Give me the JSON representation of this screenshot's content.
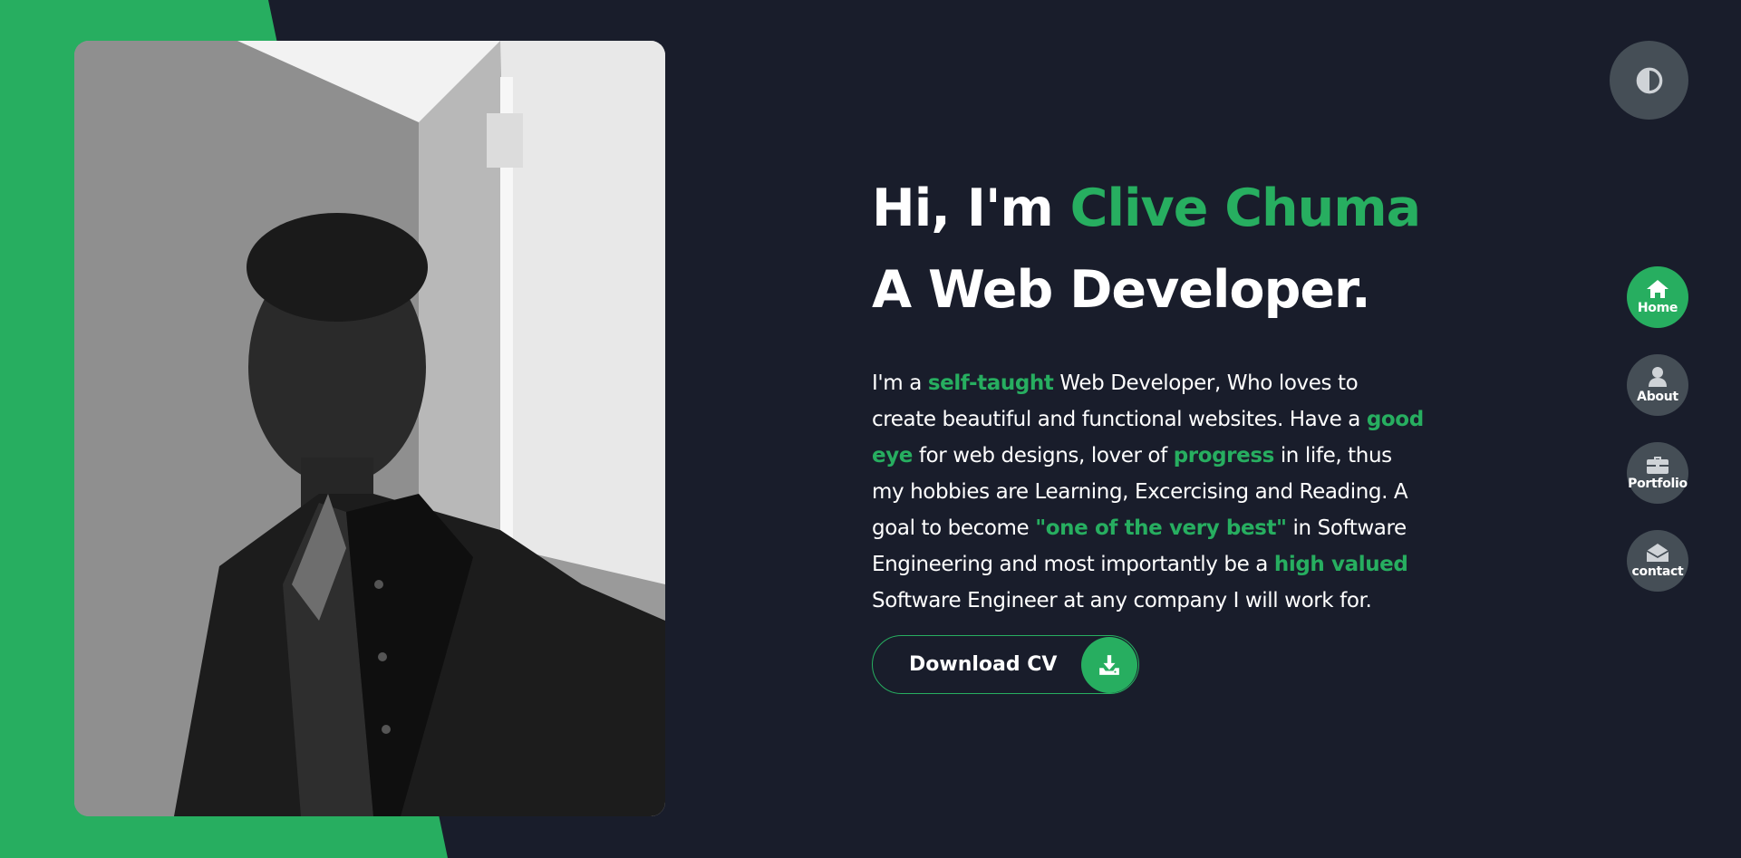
{
  "colors": {
    "background": "#191d2b",
    "accent": "#27ae60",
    "nav_inactive": "#454e56",
    "text": "#ffffff"
  },
  "hero": {
    "greeting": "Hi, I'm ",
    "name": "Clive Chuma",
    "role": "A Web Developer.",
    "bio": [
      {
        "text": "I'm a ",
        "hl": false
      },
      {
        "text": "self-taught",
        "hl": true
      },
      {
        "text": " Web Developer, Who loves to create beautiful and functional websites. Have a ",
        "hl": false
      },
      {
        "text": "good eye",
        "hl": true
      },
      {
        "text": " for web designs, lover of ",
        "hl": false
      },
      {
        "text": "progress",
        "hl": true
      },
      {
        "text": " in life, thus my hobbies are Learning, Excercising and Reading. A goal to become ",
        "hl": false
      },
      {
        "text": "\"one of the very best\"",
        "hl": true
      },
      {
        "text": " in Software Engineering and most importantly be a ",
        "hl": false
      },
      {
        "text": "high valued",
        "hl": true
      },
      {
        "text": " Software Engineer at any company I will work for.",
        "hl": false
      }
    ]
  },
  "cv_button": {
    "label": "Download CV",
    "icon": "download-icon"
  },
  "theme_toggle": {
    "icon": "contrast-icon"
  },
  "nav": {
    "items": [
      {
        "label": "Home",
        "icon": "home-icon",
        "active": true
      },
      {
        "label": "About",
        "icon": "user-icon",
        "active": false
      },
      {
        "label": "Portfolio",
        "icon": "briefcase-icon",
        "active": false
      },
      {
        "label": "contact",
        "icon": "envelope-icon",
        "active": false
      }
    ]
  },
  "profile_photo": {
    "icon": "profile-photo"
  }
}
